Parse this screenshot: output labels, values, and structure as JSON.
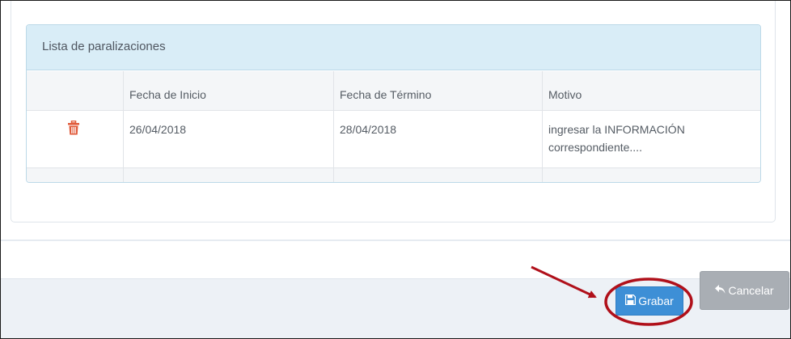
{
  "panel": {
    "title": "Lista de paralizaciones",
    "columns": [
      "",
      "Fecha de Inicio",
      "Fecha de Término",
      "Motivo"
    ],
    "rows": [
      {
        "action_icon": "trash-icon",
        "start": "26/04/2018",
        "end": "28/04/2018",
        "reason": "ingresar la INFORMACIÓN correspondiente...."
      }
    ]
  },
  "footer": {
    "save_label": "Grabar",
    "cancel_label": "Cancelar"
  },
  "colors": {
    "panel_heading_bg": "#d9edf7",
    "delete_icon": "#e05a3a",
    "save_button": "#3d8fd6",
    "cancel_button": "#a9aeb4",
    "annotation": "#b0101a"
  },
  "icons": {
    "delete": "trash-icon",
    "save": "floppy-disk-icon",
    "cancel": "undo-arrow-icon"
  }
}
